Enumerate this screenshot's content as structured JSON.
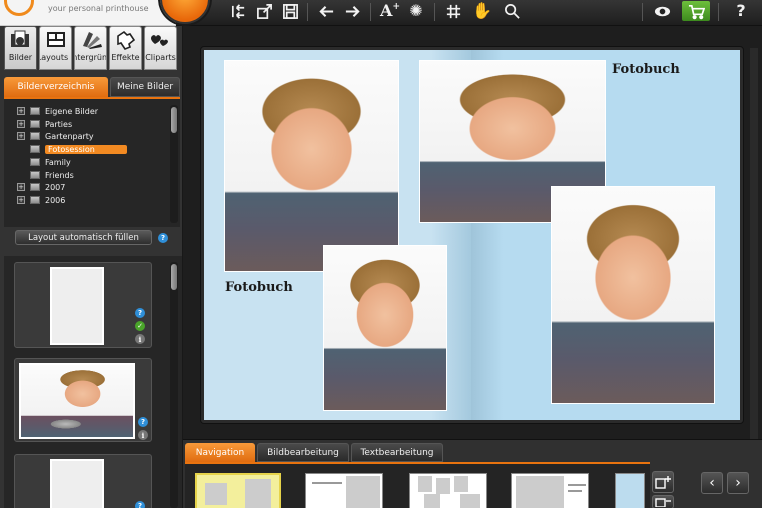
{
  "app": {
    "tagline": "your personal printhouse"
  },
  "toolbar": {
    "buttons": [
      "align-icon",
      "export-icon",
      "save-icon",
      "undo-icon",
      "redo-icon",
      "add-text-icon",
      "add-effect-icon",
      "grid-icon",
      "hand-icon",
      "zoom-icon",
      "preview-icon",
      "cart-icon",
      "help-icon"
    ],
    "help_label": "?"
  },
  "category_tabs": [
    {
      "label": "Bilder",
      "icon": "camera-icon"
    },
    {
      "label": "Layouts",
      "icon": "layouts-icon"
    },
    {
      "label": "Hintergründe",
      "icon": "swatches-icon"
    },
    {
      "label": "Effekte",
      "icon": "puzzle-icon"
    },
    {
      "label": "Cliparts",
      "icon": "clipart-icon"
    }
  ],
  "sub_tabs": {
    "directory": "Bilderverzeichnis",
    "mine": "Meine Bilder"
  },
  "tree": [
    {
      "label": "Eigene Bilder",
      "expandable": true
    },
    {
      "label": "Parties",
      "expandable": true
    },
    {
      "label": "Gartenparty",
      "expandable": true
    },
    {
      "label": "Fotosession",
      "expandable": false,
      "selected": true
    },
    {
      "label": "Family",
      "expandable": false
    },
    {
      "label": "Friends",
      "expandable": false
    },
    {
      "label": "2007",
      "expandable": true
    },
    {
      "label": "2006",
      "expandable": true
    }
  ],
  "autofill_label": "Layout automatisch füllen",
  "badges": {
    "help": "?",
    "ok": "✓",
    "info": "i"
  },
  "book": {
    "left_title": "Fotobuch",
    "right_title": "Fotobuch"
  },
  "bottom_tabs": {
    "navigation": "Navigation",
    "image_edit": "Bildbearbeitung",
    "text_edit": "Textbearbeitung"
  },
  "nav": {
    "prev": "‹",
    "next": "›"
  }
}
